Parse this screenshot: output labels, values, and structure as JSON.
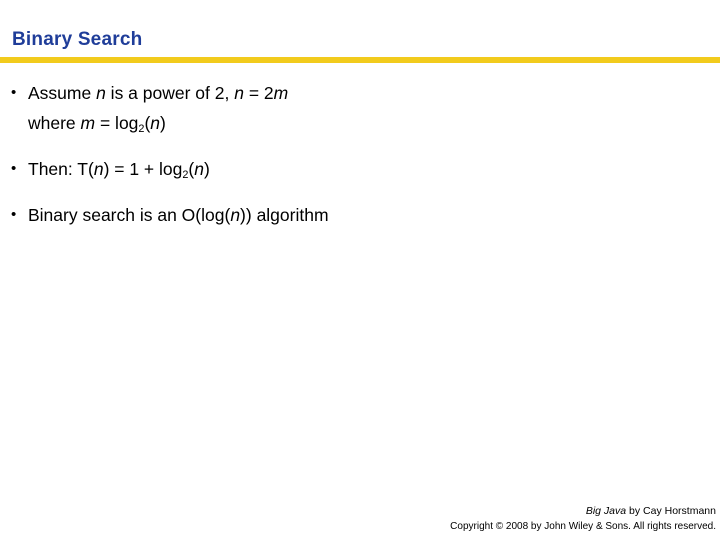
{
  "colors": {
    "title": "#1F3D99",
    "rule": "#F2CB1D",
    "text": "#000000",
    "background": "#FFFFFF"
  },
  "header": {
    "title": "Binary Search"
  },
  "body": {
    "bullet_glyph": "•",
    "bullets": [
      {
        "lines": [
          {
            "segments": [
              {
                "text": "Assume ",
                "style": "normal"
              },
              {
                "text": "n",
                "style": "italic"
              },
              {
                "text": " is a power of 2, ",
                "style": "normal"
              },
              {
                "text": "n",
                "style": "italic"
              },
              {
                "text": " = 2",
                "style": "normal"
              },
              {
                "text": "m",
                "style": "italic"
              }
            ],
            "plain": "Assume n is a power of 2, n = 2m"
          },
          {
            "segments": [
              {
                "text": "where ",
                "style": "normal"
              },
              {
                "text": "m",
                "style": "italic"
              },
              {
                "text": " = log",
                "style": "normal"
              },
              {
                "text": "2",
                "style": "subscript"
              },
              {
                "text": "(",
                "style": "normal"
              },
              {
                "text": "n",
                "style": "italic"
              },
              {
                "text": ")",
                "style": "normal"
              }
            ],
            "plain": "where m = log2(n)"
          }
        ]
      },
      {
        "lines": [
          {
            "segments": [
              {
                "text": "Then: T(",
                "style": "normal"
              },
              {
                "text": "n",
                "style": "italic"
              },
              {
                "text": ") = 1 + log",
                "style": "normal"
              },
              {
                "text": "2",
                "style": "subscript"
              },
              {
                "text": "(",
                "style": "normal"
              },
              {
                "text": "n",
                "style": "italic"
              },
              {
                "text": ")",
                "style": "normal"
              }
            ],
            "plain": "Then: T(n) = 1 + log2(n)"
          }
        ]
      },
      {
        "lines": [
          {
            "segments": [
              {
                "text": "Binary search is an O(log(",
                "style": "normal"
              },
              {
                "text": "n",
                "style": "italic"
              },
              {
                "text": ")) algorithm",
                "style": "normal"
              }
            ],
            "plain": "Binary search is an O(log(n)) algorithm"
          }
        ]
      }
    ]
  },
  "footer": {
    "credit_work": "Big Java",
    "credit_rest": " by Cay Horstmann",
    "copyright": "Copyright © 2008 by John Wiley & Sons.  All rights reserved."
  }
}
